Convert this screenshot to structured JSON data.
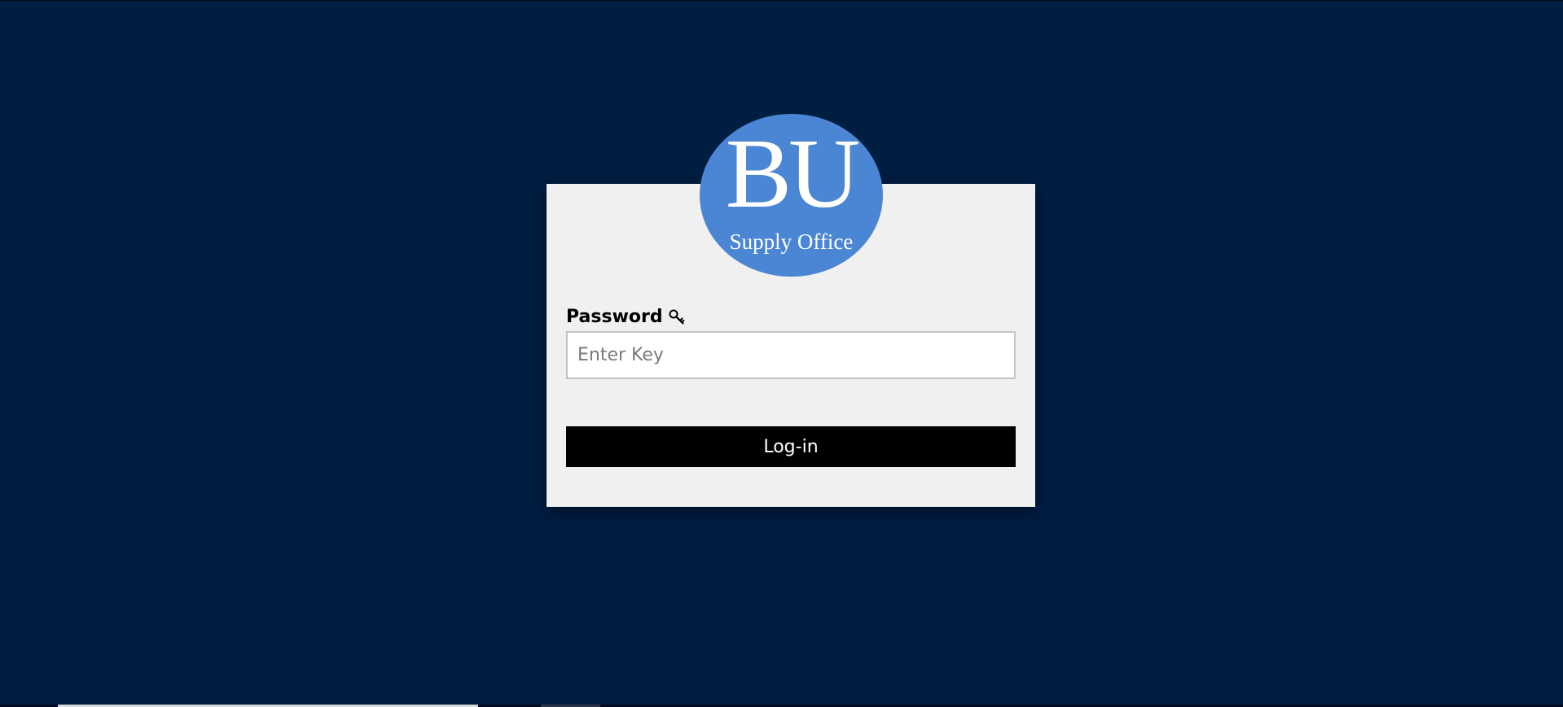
{
  "logo": {
    "main_text": "BU",
    "sub_text": "Supply Office"
  },
  "login_form": {
    "password_label": "Password",
    "password_icon": "key-icon",
    "password_placeholder": "Enter Key",
    "password_value": "",
    "login_button_label": "Log-in"
  },
  "colors": {
    "background": "#001d42",
    "card_background": "#f0f0f0",
    "logo_circle": "#4a86d4",
    "button_background": "#000000",
    "button_text": "#ffffff"
  }
}
